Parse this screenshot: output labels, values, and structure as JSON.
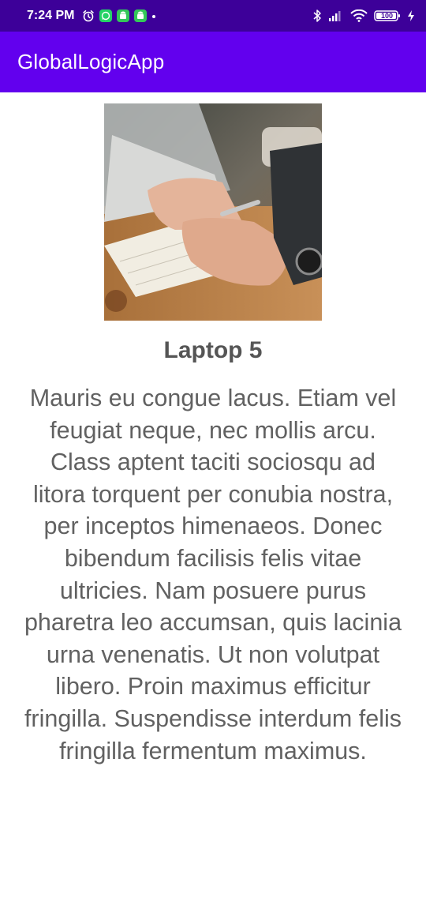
{
  "status_bar": {
    "time": "7:24 PM",
    "battery_level": "100",
    "icons": [
      "alarm-icon",
      "whatsapp-icon",
      "android-icon",
      "android-icon",
      "dot-icon",
      "bluetooth-icon",
      "signal-icon",
      "wifi-icon",
      "battery-icon",
      "charging-icon"
    ]
  },
  "app_bar": {
    "title": "GlobalLogicApp"
  },
  "product": {
    "image": "laptop-photo",
    "title": "Laptop 5",
    "description": "Mauris eu congue lacus. Etiam vel feugiat neque, nec mollis arcu. Class aptent taciti sociosqu ad litora torquent per conubia nostra, per inceptos himenaeos. Donec bibendum facilisis felis vitae ultricies. Nam posuere purus pharetra leo accumsan, quis lacinia urna venenatis. Ut non volutpat libero. Proin maximus efficitur fringilla. Suspendisse interdum felis fringilla fermentum maximus."
  },
  "colors": {
    "status_bar": "#3d0099",
    "app_bar": "#6200ee",
    "text": "#616161",
    "whatsapp": "#25d366"
  }
}
